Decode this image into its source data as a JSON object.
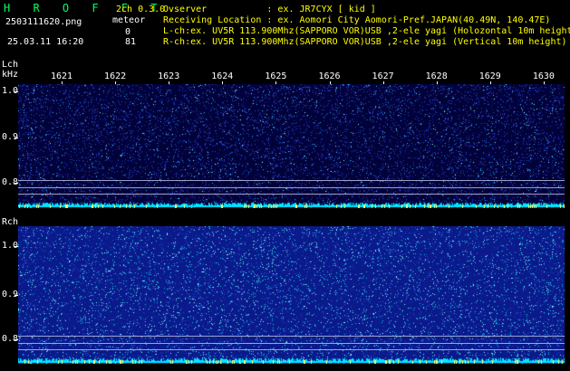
{
  "header": {
    "app_title": "H R O F F T",
    "mode": "2ch 0.3.0",
    "filename": "2503111620.png",
    "meteor_label": "meteor",
    "count_l": "0",
    "count_r": "81",
    "datetime": "25.03.11 16:20",
    "observer_line": "Ovserver           : ex. JR7CYX [ kid ]",
    "location_line": "Receiving Location : ex. Aomori City Aomori-Pref.JAPAN(40.49N, 140.47E)",
    "lch_line": "L-ch:ex. UV5R 113.900Mhz(SAPPORO VOR)USB ,2-ele yagi (Holozontal 10m height)",
    "rch_line": "R-ch:ex. UV5R 113.900Mhz(SAPPORO VOR)USB ,2-ele yagi (Vertical 10m height)"
  },
  "lch": {
    "label": "Lch",
    "unit": "kHz",
    "y_labels": [
      "1.0",
      "0.9",
      "0.8"
    ]
  },
  "rch": {
    "label": "Rch",
    "y_labels": [
      "1.0",
      "0.9",
      "0.8"
    ]
  },
  "time_axis": {
    "ticks": [
      "1621",
      "1622",
      "1623",
      "1624",
      "1625",
      "1626",
      "1627",
      "1628",
      "1629",
      "1630"
    ]
  },
  "colors": {
    "background": "#000000",
    "header_yellow": "#ffff00",
    "title_green": "#00ff66",
    "lch_panel": "#02023a",
    "rch_panel": "#0a1a8a",
    "noise_cyan": "#00ffff"
  }
}
